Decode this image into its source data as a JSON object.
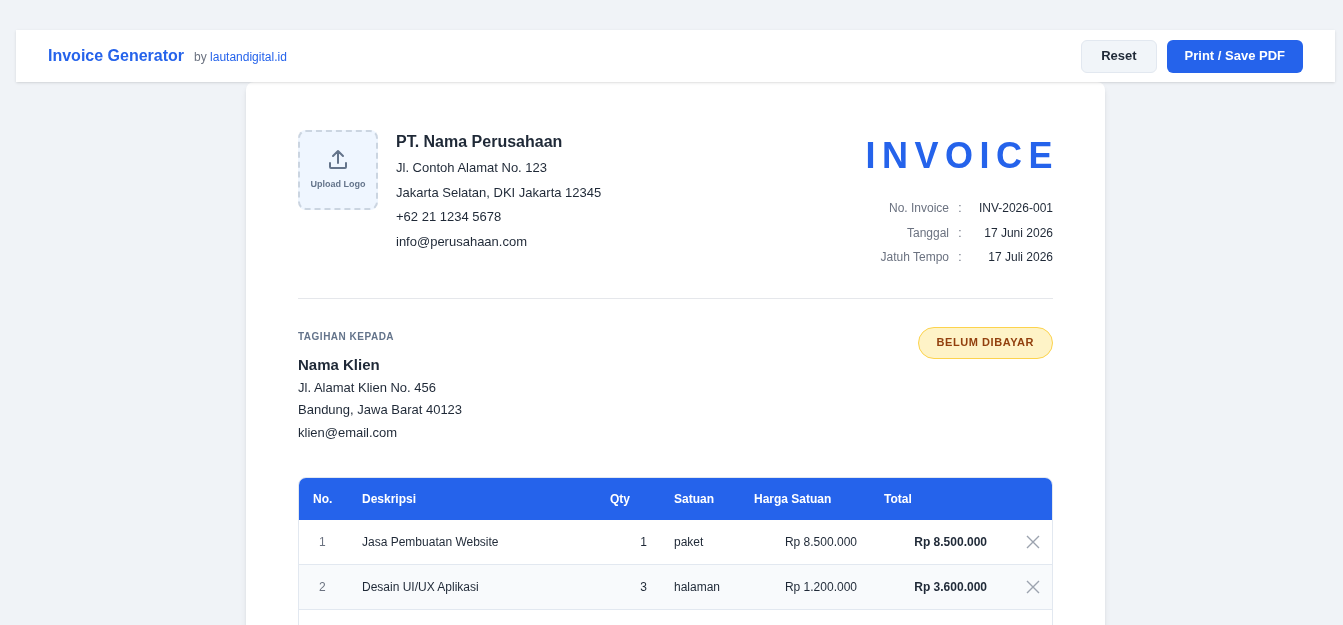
{
  "topbar": {
    "title": "Invoice Generator",
    "by": "by",
    "site": "lautandigital.id",
    "buttons": [
      {
        "label": "Reset",
        "kind": "secondary"
      },
      {
        "label": "Print / Save PDF",
        "kind": "primary"
      }
    ]
  },
  "company": {
    "logo_label": "Upload Logo",
    "name": "PT. Nama Perusahaan",
    "lines": [
      "Jl. Contoh Alamat No. 123",
      "Jakarta Selatan, DKI Jakarta 12345",
      "+62 21 1234 5678",
      "info@perusahaan.com"
    ]
  },
  "invoice": {
    "title": "INVOICE",
    "meta": [
      {
        "label": "No. Invoice",
        "separator": ":",
        "value": "INV-2026-001"
      },
      {
        "label": "Tanggal",
        "separator": ":",
        "value": "17 Juni 2026"
      },
      {
        "label": "Jatuh Tempo",
        "separator": ":",
        "value": "17 Juli 2026"
      }
    ]
  },
  "bill_to": {
    "heading": "TAGIHAN KEPADA",
    "name": "Nama Klien",
    "lines": [
      "Jl. Alamat Klien No. 456",
      "Bandung, Jawa Barat 40123",
      "klien@email.com"
    ]
  },
  "status": {
    "label": "BELUM DIBAYAR",
    "paid": false
  },
  "table": {
    "columns": [
      "No.",
      "Deskripsi",
      "Qty",
      "Satuan",
      "Harga Satuan",
      "Total"
    ],
    "rows": [
      {
        "no": "1",
        "description": "Jasa Pembuatan Website",
        "qty": "1",
        "unit": "paket",
        "price": "Rp 8.500.000",
        "total": "Rp 8.500.000"
      },
      {
        "no": "2",
        "description": "Desain UI/UX Aplikasi",
        "qty": "3",
        "unit": "halaman",
        "price": "Rp 1.200.000",
        "total": "Rp 3.600.000"
      }
    ]
  }
}
